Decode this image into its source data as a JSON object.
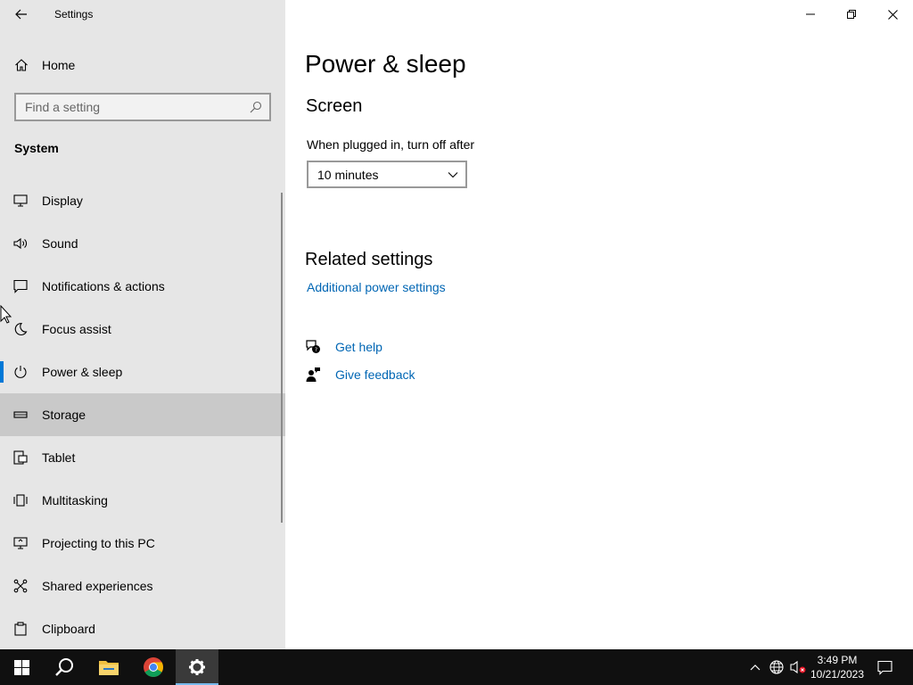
{
  "window": {
    "title": "Settings"
  },
  "sidebar": {
    "home_label": "Home",
    "search_placeholder": "Find a setting",
    "section_title": "System",
    "items": [
      {
        "label": "Display",
        "icon": "monitor-icon"
      },
      {
        "label": "Sound",
        "icon": "speaker-icon"
      },
      {
        "label": "Notifications & actions",
        "icon": "notification-icon"
      },
      {
        "label": "Focus assist",
        "icon": "moon-icon"
      },
      {
        "label": "Power & sleep",
        "icon": "power-icon",
        "selected": true
      },
      {
        "label": "Storage",
        "icon": "storage-icon",
        "hovered": true
      },
      {
        "label": "Tablet",
        "icon": "tablet-icon"
      },
      {
        "label": "Multitasking",
        "icon": "multitasking-icon"
      },
      {
        "label": "Projecting to this PC",
        "icon": "projecting-icon"
      },
      {
        "label": "Shared experiences",
        "icon": "shared-experiences-icon"
      },
      {
        "label": "Clipboard",
        "icon": "clipboard-icon"
      }
    ]
  },
  "main": {
    "page_title": "Power & sleep",
    "screen_section": {
      "title": "Screen",
      "plugged_in_label": "When plugged in, turn off after",
      "plugged_in_value": "10 minutes"
    },
    "related": {
      "title": "Related settings",
      "additional_power_link": "Additional power settings"
    },
    "help": {
      "get_help": "Get help",
      "give_feedback": "Give feedback"
    }
  },
  "taskbar": {
    "apps": [
      "start",
      "search",
      "file-explorer",
      "chrome",
      "settings"
    ],
    "time": "3:49 PM",
    "date": "10/21/2023"
  },
  "colors": {
    "accent": "#0078d7",
    "link": "#0066b4",
    "sidebar_bg": "#e6e6e6",
    "hover_bg": "#c9c9c9",
    "taskbar_bg": "#101010"
  }
}
